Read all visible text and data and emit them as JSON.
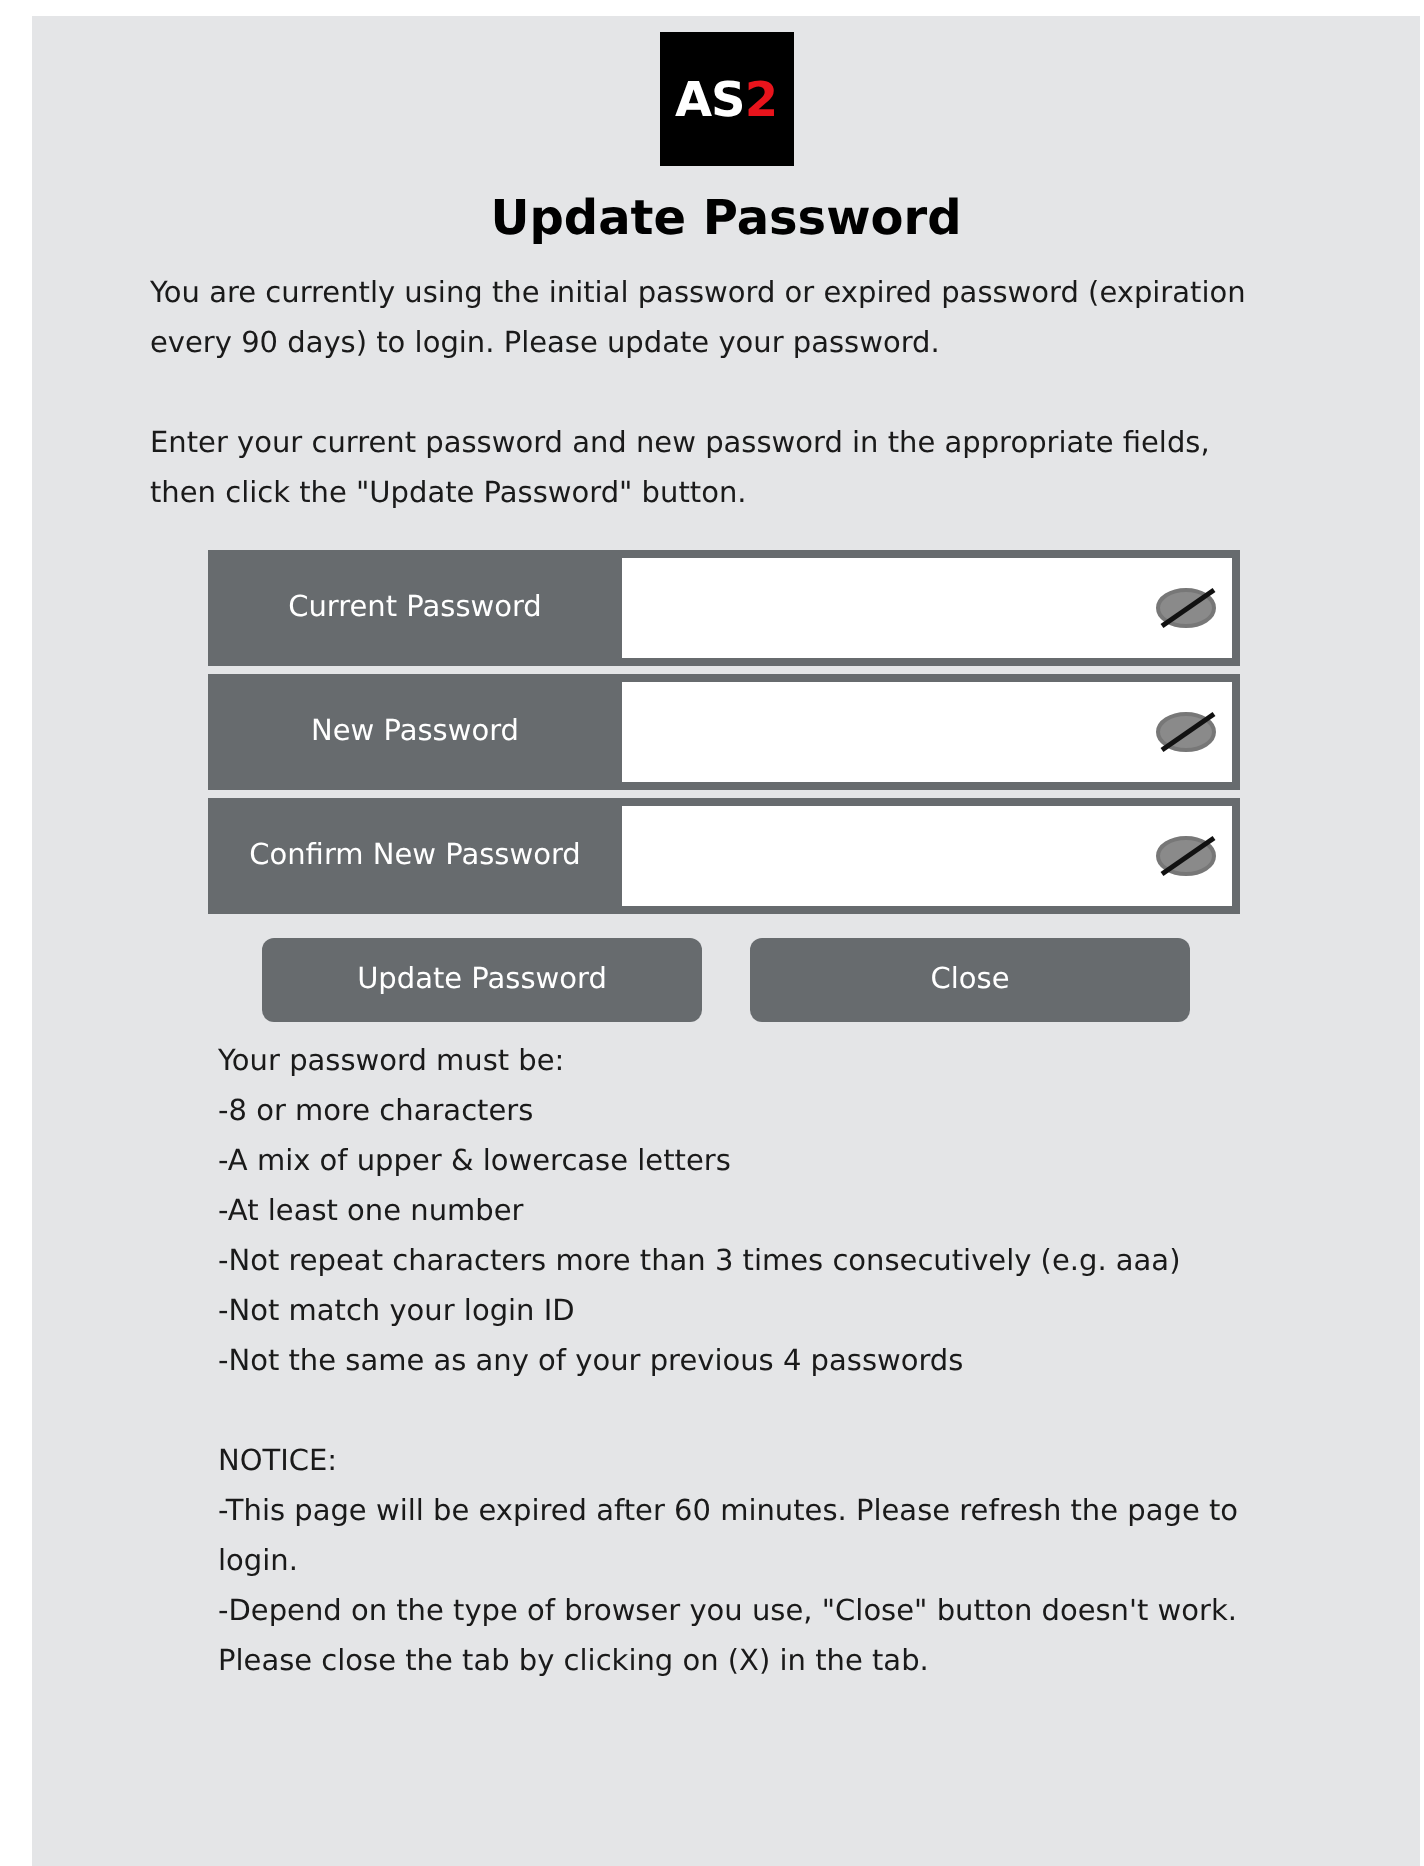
{
  "logo": {
    "text": "AS",
    "accent": "2"
  },
  "title": "Update Password",
  "intro": [
    "You are currently using the initial password or expired password (expiration every 90 days) to login. Please update your password.",
    "Enter your current password and new password in the appropriate fields, then click the \"Update Password\" button."
  ],
  "fields": [
    {
      "label": "Current Password"
    },
    {
      "label": "New Password"
    },
    {
      "label": "Confirm New Password"
    }
  ],
  "buttons": [
    "Update Password",
    "Close"
  ],
  "requirements": {
    "heading": "Your password must be:",
    "items": [
      "-8 or more characters",
      "-A mix of upper & lowercase letters",
      "-At least one number",
      "-Not repeat characters more than 3 times consecutively (e.g. aaa)",
      "-Not match your login ID",
      "-Not the same as any of your previous 4 passwords"
    ]
  },
  "notice": {
    "heading": "NOTICE:",
    "items": [
      "-This page will be expired after 60 minutes. Please refresh the page to login.",
      "-Depend on the type of browser you use, \"Close\" button doesn't work. Please close the tab by clicking on (X) in the tab."
    ]
  }
}
